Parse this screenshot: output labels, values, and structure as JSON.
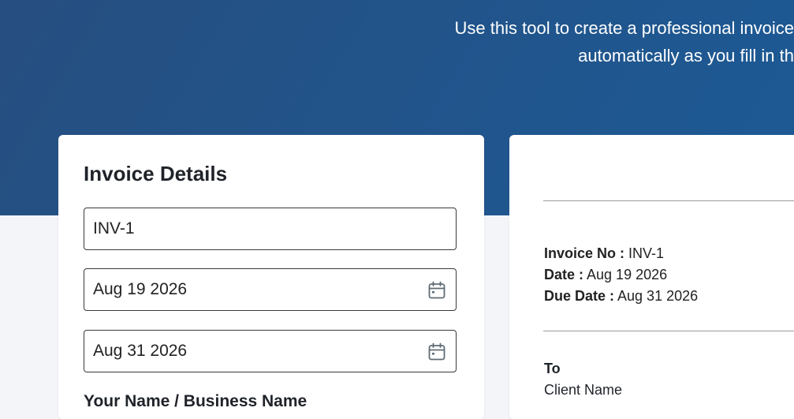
{
  "hero": {
    "line1": "Use this tool to create a professional invoice",
    "line2": "automatically as you fill in th"
  },
  "form": {
    "title": "Invoice Details",
    "invoice_number": "INV-1",
    "invoice_date": "Aug 19 2026",
    "due_date": "Aug 31 2026",
    "business_name_label": "Your Name / Business Name",
    "date_icon": "calendar-icon"
  },
  "preview": {
    "invoice_no_label": "Invoice No :",
    "invoice_no_value": "INV-1",
    "date_label": "Date :",
    "date_value": "Aug 19 2026",
    "due_date_label": "Due Date :",
    "due_date_value": "Aug 31 2026",
    "to_label": "To",
    "client_name": "Client Name"
  }
}
